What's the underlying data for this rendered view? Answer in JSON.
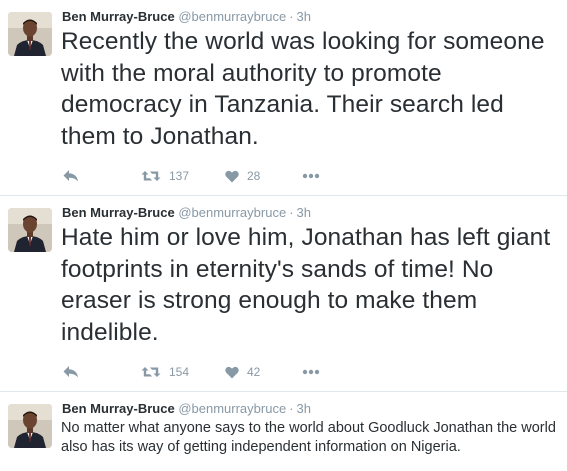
{
  "colors": {
    "text": "#292f33",
    "muted": "#8899a6",
    "divider": "#e1e8ed",
    "background": "#ffffff"
  },
  "tweets": [
    {
      "name": "Ben Murray-Bruce",
      "handle": "@benmurraybruce",
      "separator": "·",
      "time": "3h",
      "text": "Recently the world was looking for someone with the moral authority to promote democracy in Tanzania. Their search led them to Jonathan.",
      "retweets": "137",
      "likes": "28",
      "icons": [
        "reply-icon",
        "retweet-icon",
        "heart-icon",
        "more-icon"
      ]
    },
    {
      "name": "Ben Murray-Bruce",
      "handle": "@benmurraybruce",
      "separator": "·",
      "time": "3h",
      "text": "Hate him or love him, Jonathan has left giant footprints in eternity's sands of time! No eraser is strong enough to make them indelible.",
      "retweets": "154",
      "likes": "42",
      "icons": [
        "reply-icon",
        "retweet-icon",
        "heart-icon",
        "more-icon"
      ]
    },
    {
      "name": "Ben Murray-Bruce",
      "handle": "@benmurraybruce",
      "separator": "·",
      "time": "3h",
      "text": "No matter what anyone says to the world about Goodluck Jonathan the world also has its way of getting independent information on Nigeria."
    }
  ]
}
